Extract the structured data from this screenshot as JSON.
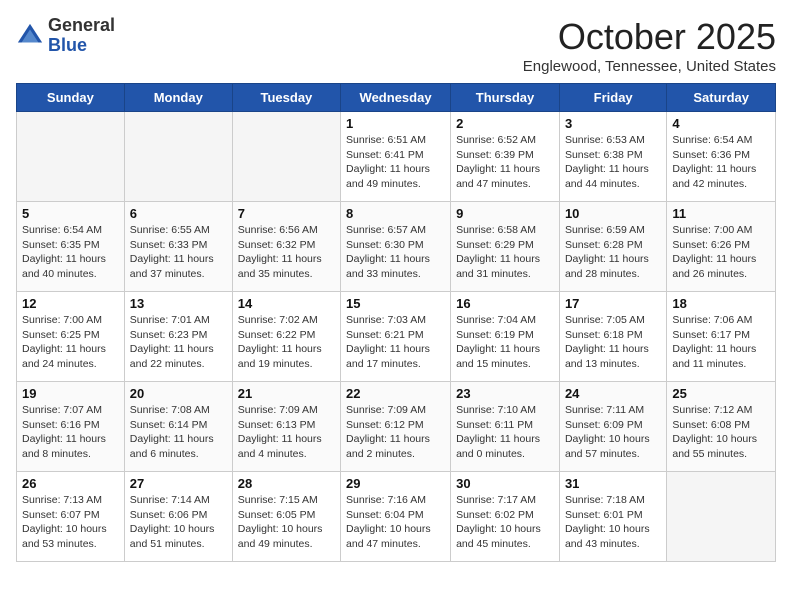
{
  "header": {
    "logo_general": "General",
    "logo_blue": "Blue",
    "month_title": "October 2025",
    "location": "Englewood, Tennessee, United States"
  },
  "days_of_week": [
    "Sunday",
    "Monday",
    "Tuesday",
    "Wednesday",
    "Thursday",
    "Friday",
    "Saturday"
  ],
  "weeks": [
    [
      {
        "day": "",
        "content": ""
      },
      {
        "day": "",
        "content": ""
      },
      {
        "day": "",
        "content": ""
      },
      {
        "day": "1",
        "content": "Sunrise: 6:51 AM\nSunset: 6:41 PM\nDaylight: 11 hours\nand 49 minutes."
      },
      {
        "day": "2",
        "content": "Sunrise: 6:52 AM\nSunset: 6:39 PM\nDaylight: 11 hours\nand 47 minutes."
      },
      {
        "day": "3",
        "content": "Sunrise: 6:53 AM\nSunset: 6:38 PM\nDaylight: 11 hours\nand 44 minutes."
      },
      {
        "day": "4",
        "content": "Sunrise: 6:54 AM\nSunset: 6:36 PM\nDaylight: 11 hours\nand 42 minutes."
      }
    ],
    [
      {
        "day": "5",
        "content": "Sunrise: 6:54 AM\nSunset: 6:35 PM\nDaylight: 11 hours\nand 40 minutes."
      },
      {
        "day": "6",
        "content": "Sunrise: 6:55 AM\nSunset: 6:33 PM\nDaylight: 11 hours\nand 37 minutes."
      },
      {
        "day": "7",
        "content": "Sunrise: 6:56 AM\nSunset: 6:32 PM\nDaylight: 11 hours\nand 35 minutes."
      },
      {
        "day": "8",
        "content": "Sunrise: 6:57 AM\nSunset: 6:30 PM\nDaylight: 11 hours\nand 33 minutes."
      },
      {
        "day": "9",
        "content": "Sunrise: 6:58 AM\nSunset: 6:29 PM\nDaylight: 11 hours\nand 31 minutes."
      },
      {
        "day": "10",
        "content": "Sunrise: 6:59 AM\nSunset: 6:28 PM\nDaylight: 11 hours\nand 28 minutes."
      },
      {
        "day": "11",
        "content": "Sunrise: 7:00 AM\nSunset: 6:26 PM\nDaylight: 11 hours\nand 26 minutes."
      }
    ],
    [
      {
        "day": "12",
        "content": "Sunrise: 7:00 AM\nSunset: 6:25 PM\nDaylight: 11 hours\nand 24 minutes."
      },
      {
        "day": "13",
        "content": "Sunrise: 7:01 AM\nSunset: 6:23 PM\nDaylight: 11 hours\nand 22 minutes."
      },
      {
        "day": "14",
        "content": "Sunrise: 7:02 AM\nSunset: 6:22 PM\nDaylight: 11 hours\nand 19 minutes."
      },
      {
        "day": "15",
        "content": "Sunrise: 7:03 AM\nSunset: 6:21 PM\nDaylight: 11 hours\nand 17 minutes."
      },
      {
        "day": "16",
        "content": "Sunrise: 7:04 AM\nSunset: 6:19 PM\nDaylight: 11 hours\nand 15 minutes."
      },
      {
        "day": "17",
        "content": "Sunrise: 7:05 AM\nSunset: 6:18 PM\nDaylight: 11 hours\nand 13 minutes."
      },
      {
        "day": "18",
        "content": "Sunrise: 7:06 AM\nSunset: 6:17 PM\nDaylight: 11 hours\nand 11 minutes."
      }
    ],
    [
      {
        "day": "19",
        "content": "Sunrise: 7:07 AM\nSunset: 6:16 PM\nDaylight: 11 hours\nand 8 minutes."
      },
      {
        "day": "20",
        "content": "Sunrise: 7:08 AM\nSunset: 6:14 PM\nDaylight: 11 hours\nand 6 minutes."
      },
      {
        "day": "21",
        "content": "Sunrise: 7:09 AM\nSunset: 6:13 PM\nDaylight: 11 hours\nand 4 minutes."
      },
      {
        "day": "22",
        "content": "Sunrise: 7:09 AM\nSunset: 6:12 PM\nDaylight: 11 hours\nand 2 minutes."
      },
      {
        "day": "23",
        "content": "Sunrise: 7:10 AM\nSunset: 6:11 PM\nDaylight: 11 hours\nand 0 minutes."
      },
      {
        "day": "24",
        "content": "Sunrise: 7:11 AM\nSunset: 6:09 PM\nDaylight: 10 hours\nand 57 minutes."
      },
      {
        "day": "25",
        "content": "Sunrise: 7:12 AM\nSunset: 6:08 PM\nDaylight: 10 hours\nand 55 minutes."
      }
    ],
    [
      {
        "day": "26",
        "content": "Sunrise: 7:13 AM\nSunset: 6:07 PM\nDaylight: 10 hours\nand 53 minutes."
      },
      {
        "day": "27",
        "content": "Sunrise: 7:14 AM\nSunset: 6:06 PM\nDaylight: 10 hours\nand 51 minutes."
      },
      {
        "day": "28",
        "content": "Sunrise: 7:15 AM\nSunset: 6:05 PM\nDaylight: 10 hours\nand 49 minutes."
      },
      {
        "day": "29",
        "content": "Sunrise: 7:16 AM\nSunset: 6:04 PM\nDaylight: 10 hours\nand 47 minutes."
      },
      {
        "day": "30",
        "content": "Sunrise: 7:17 AM\nSunset: 6:02 PM\nDaylight: 10 hours\nand 45 minutes."
      },
      {
        "day": "31",
        "content": "Sunrise: 7:18 AM\nSunset: 6:01 PM\nDaylight: 10 hours\nand 43 minutes."
      },
      {
        "day": "",
        "content": ""
      }
    ]
  ]
}
